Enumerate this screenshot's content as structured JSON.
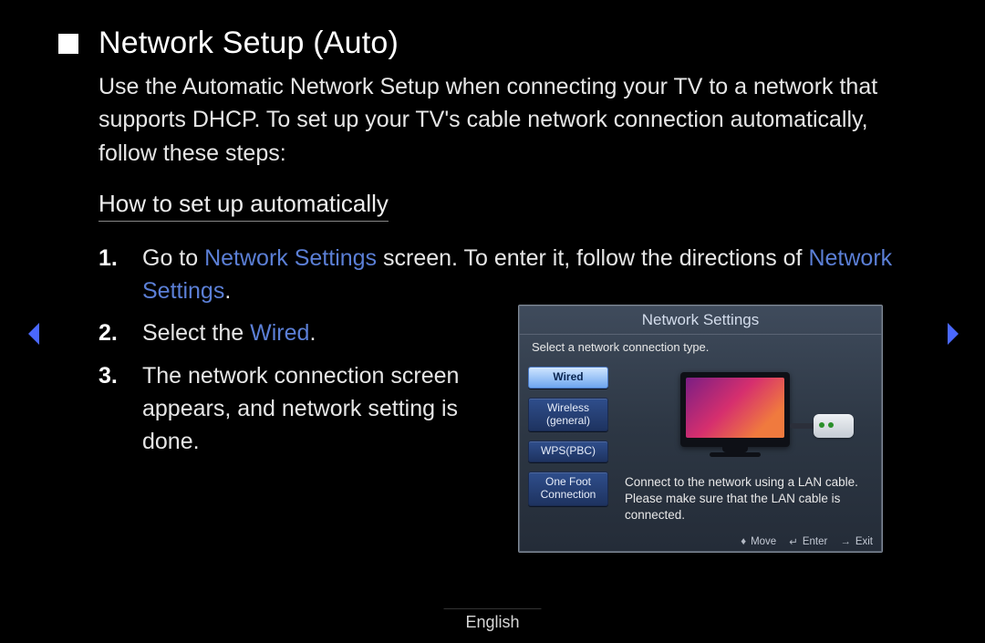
{
  "heading": "Network Setup (Auto)",
  "intro": "Use the Automatic Network Setup when connecting your TV to a network that supports DHCP. To set up your TV's cable network connection automatically, follow these steps:",
  "subheading": "How to set up automatically",
  "steps": {
    "s1_a": "Go to ",
    "s1_b": "Network Settings",
    "s1_c": " screen. To enter it, follow the directions of ",
    "s1_d": "Network Settings",
    "s1_e": ".",
    "s2_a": "Select the ",
    "s2_b": "Wired",
    "s2_c": ".",
    "s3": "The network connection screen appears, and network setting is done."
  },
  "tv": {
    "title": "Network Settings",
    "subtitle": "Select a network connection type.",
    "options": {
      "wired": "Wired",
      "wireless": "Wireless (general)",
      "wps": "WPS(PBC)",
      "onefoot": "One Foot Connection"
    },
    "desc": "Connect to the network using a LAN cable. Please make sure that the LAN cable is connected.",
    "hints": {
      "move": "Move",
      "enter": "Enter",
      "exit": "Exit"
    }
  },
  "footer_language": "English"
}
